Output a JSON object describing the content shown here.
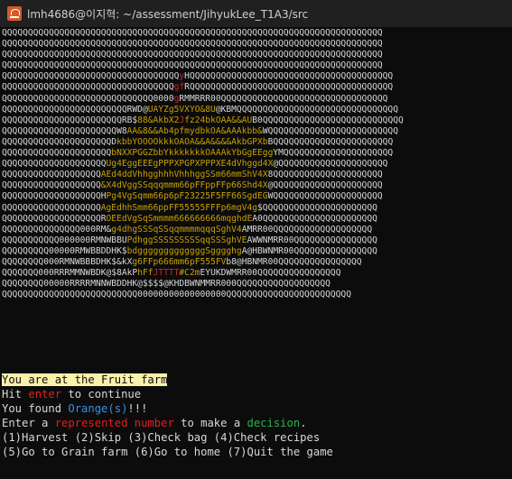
{
  "window": {
    "title": "lmh4686@이지혁: ~/assessment/JihyukLee_T1A3/src"
  },
  "art": {
    "colors": {
      "gold": "#c8a000",
      "red": "#c5282f",
      "amber": "#e0a020",
      "white": "#d8d8d8"
    },
    "lines": [
      [
        {
          "t": "QQQQQQQQQQQQQQQQQQQQQQQQQQQQQQQQQQQQQQQQQQQQQQQQQQQQQQQQQQQQQQQQQQQQQQQQQ",
          "c": "w"
        }
      ],
      [
        {
          "t": "QQQQQQQQQQQQQQQQQQQQQQQQQQQQQQQQQQQQQQQQQQQQQQQQQQQQQQQQQQQQQQQQQQQQQQQQQ",
          "c": "w"
        }
      ],
      [
        {
          "t": "QQQQQQQQQQQQQQQQQQQQQQQQQQQQQQQQQQQQQQQQQQQQQQQQQQQQQQQQQQQQQQQQQQQQQQQQQ",
          "c": "w"
        }
      ],
      [
        {
          "t": "QQQQQQQQQQQQQQQQQQQQQQQQQQQQQQQQQQQQQQQQQQQQQQQQQQQQQQQQQQQQQQQQQQQQQQQQQ",
          "c": "w"
        }
      ],
      [
        {
          "t": "QQQQQQQQQQQQQQQQQQQQQQQQQQQQQQQQQQ",
          "c": "w"
        },
        {
          "t": "y",
          "c": "r"
        },
        {
          "t": "HQQQQQQQQQQQQQQQQQQQQQQQQQQQQQQQQQQQQQQQ",
          "c": "w"
        }
      ],
      [
        {
          "t": "QQQQQQQQQQQQQQQQQQQQQQQQQQQQQQQQQ",
          "c": "w"
        },
        {
          "t": "gf",
          "c": "r"
        },
        {
          "t": "RQQQQQQQQQQQQQQQQQQQQQQQQQQQQQQQQQQQQQQQ",
          "c": "w"
        }
      ],
      [
        {
          "t": "QQQQQQQQQQQQQQQQQQQQQQQQQQQQQ0000",
          "c": "w"
        },
        {
          "t": "g",
          "c": "r"
        },
        {
          "t": "RMMRRR00QQQQQQQQQQQQQQQQQQQQQQQQQQQQQQQQ",
          "c": "w"
        }
      ],
      [
        {
          "t": "QQQQQQQQQQQQQQQQQQQQQQQQRWD@",
          "c": "w"
        },
        {
          "t": "UAYZg5VXYO&8U",
          "c": "g"
        },
        {
          "t": "@KBMQQQQQQQQQQQQQQQQQQQQQQQQQQQQQQQ",
          "c": "w"
        }
      ],
      [
        {
          "t": "QQQQQQQQQQQQQQQQQQQQQQQRB$",
          "c": "w"
        },
        {
          "t": "88&AkbX2",
          "c": "g"
        },
        {
          "t": "J",
          "c": "r"
        },
        {
          "t": "fz24bkOAA&&AU",
          "c": "g"
        },
        {
          "t": "B0QQQQQQQQQQQQQQQQQQQQQQQQQQQ",
          "c": "w"
        }
      ],
      [
        {
          "t": "QQQQQQQQQQQQQQQQQQQQQQW8",
          "c": "w"
        },
        {
          "t": "AA&8&&Ab4pfmydbkOA&AAAkbb&",
          "c": "g"
        },
        {
          "t": "WQQQQQQQQQQQQQQQQQQQQQQQQQ",
          "c": "w"
        }
      ],
      [
        {
          "t": "QQQQQQQQQQQQQQQQQQQQQD",
          "c": "w"
        },
        {
          "t": "kbbYOOOOkkkOAOA&&A&&&&AkbGPXb",
          "c": "g"
        },
        {
          "t": "BQQQQQQQQQQQQQQQQQQQQQQQ",
          "c": "w"
        }
      ],
      [
        {
          "t": "QQQQQQQQQQQQQQQQQQQQQ",
          "c": "w"
        },
        {
          "t": "bNXXPGGZbbYkkkkkkkOAAAkYbGgEEgg",
          "c": "g"
        },
        {
          "t": "YMQQQQQQQQQQQQQQQQQQQQQ",
          "c": "w"
        }
      ],
      [
        {
          "t": "QQQQQQQQQQQQQQQQQQQQ",
          "c": "w"
        },
        {
          "t": "Ug4EggEEEgPPPXPGPXPPPXE4dVhggd4X",
          "c": "g"
        },
        {
          "t": "@QQQQQQQQQQQQQQQQQQQQQ",
          "c": "w"
        }
      ],
      [
        {
          "t": "QQQQQQQQQQQQQQQQQQQ",
          "c": "w"
        },
        {
          "t": "AEd4ddVhhgghhhVhhhggSSm66mmShV4X",
          "c": "g"
        },
        {
          "t": "8QQQQQQQQQQQQQQQQQQQQQ",
          "c": "w"
        }
      ],
      [
        {
          "t": "QQQQQQQQQQQQQQQQQQQ",
          "c": "w"
        },
        {
          "t": "&X4dVggSSqqqmmm66pFFppFFp66Shd4X",
          "c": "g"
        },
        {
          "t": "@QQQQQQQQQQQQQQQQQQQQQ",
          "c": "w"
        }
      ],
      [
        {
          "t": "QQQQQQQQQQQQQQQQQQQH",
          "c": "w"
        },
        {
          "t": "Pg4VgSqmm66p6pF23225F5FF66SgdEG",
          "c": "g"
        },
        {
          "t": "WQQQQQQQQQQQQQQQQQQQQQ",
          "c": "w"
        }
      ],
      [
        {
          "t": "QQQQQQQQQQQQQQQQQQQ",
          "c": "w"
        },
        {
          "t": "AgEdhhSmm66ppFF55555FFFp6mgV4g",
          "c": "g"
        },
        {
          "t": "$QQQQQQQQQQQQQQQQQQQQQQ",
          "c": "w"
        }
      ],
      [
        {
          "t": "QQQQQQQQQQQQQQQQQQQR",
          "c": "w"
        },
        {
          "t": "OEEdVgSqSmmmm666666666mqghdE",
          "c": "g"
        },
        {
          "t": "A0QQQQQQQQQQQQQQQQQQQQQQ",
          "c": "w"
        }
      ],
      [
        {
          "t": "QQQQQQQQQQQQQQQ000RM&",
          "c": "w"
        },
        {
          "t": "g4dhgSSSqSSqqmmmmqqqSghV4",
          "c": "g"
        },
        {
          "t": "AMRR00QQQQQQQQQQQQQQQQQQQ",
          "c": "w"
        }
      ],
      [
        {
          "t": "QQQQQQQQQQQ000000RMNWBBU",
          "c": "w"
        },
        {
          "t": "PdhggSSSSSSSSSqqSSSghVE",
          "c": "g"
        },
        {
          "t": "AWWNMRR00QQQQQQQQQQQQQQQQ",
          "c": "w"
        }
      ],
      [
        {
          "t": "QQQQQQQQQ00000RMWBBDDHK$",
          "c": "w"
        },
        {
          "t": "bdgggggggggggggSgggghg",
          "c": "g"
        },
        {
          "t": "A@HBWNMR00QQQQQQQQQQQQQQQQ",
          "c": "w"
        }
      ],
      [
        {
          "t": "QQQQQQQQ000RMNWBBBDHK$&kX",
          "c": "w"
        },
        {
          "t": "g6FFp666mm6pF555FV",
          "c": "g"
        },
        {
          "t": "b8@HBNMR00QQQQQQQQQQQQQQQQ",
          "c": "w"
        }
      ],
      [
        {
          "t": "QQQQQQQ000RRRMMNWBDK@$8AkP",
          "c": "w"
        },
        {
          "t": "hFf",
          "c": "g"
        },
        {
          "t": "JTTTT",
          "c": "r"
        },
        {
          "t": "#C2m",
          "c": "g"
        },
        {
          "t": "EYUKDWMRR00QQQQQQQQQQQQQQQQ",
          "c": "w"
        }
      ],
      [
        {
          "t": "QQQQQQQQ00000RRRRMNNWBDDHK@$$$$@KHDBWNMMRR000QQQQQQQQQQQQQQQQQQ",
          "c": "w"
        }
      ],
      [
        {
          "t": "QQQQQQQQQQQQQQQQQQQQQQQQQQ00000000000000000QQQQQQQQQQQQQQQQQQQQQQQQ",
          "c": "w"
        }
      ]
    ]
  },
  "terminal": {
    "line1": "You are at the Fruit farm",
    "line2": {
      "pre": "Hit ",
      "key": "enter",
      "post": " to continue"
    },
    "line3": {
      "pre": "You found ",
      "item": "Orange(s)",
      "post": "!!!"
    },
    "line4": {
      "pre": "Enter a ",
      "rep": "represented number",
      "mid": " to make a ",
      "dec": "decision",
      "post": "."
    },
    "line5": "(1)Harvest (2)Skip (3)Check bag (4)Check recipes",
    "line6": "(5)Go to Grain farm (6)Go to home (7)Quit the game"
  }
}
